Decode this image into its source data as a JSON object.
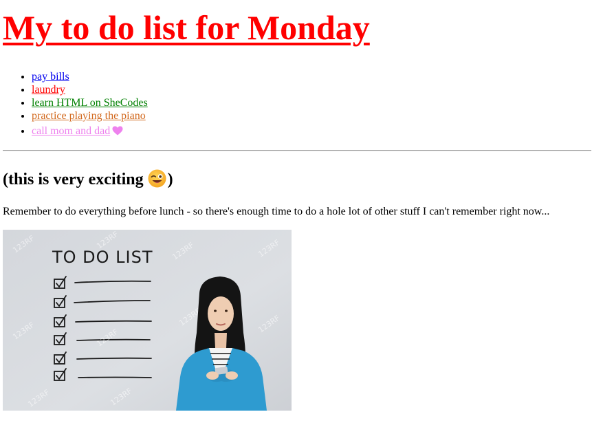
{
  "page": {
    "title": "My to do list for Monday",
    "todos": [
      {
        "label": "pay bills",
        "color": "#0000ee"
      },
      {
        "label": "laundry",
        "color": "#ff0000"
      },
      {
        "label": "learn HTML on SheCodes",
        "color": "#008000"
      },
      {
        "label": "practice playing the piano",
        "color": "#d2691e"
      },
      {
        "label": "call mom and dad",
        "color": "#ee82ee",
        "icon": "heart-icon"
      }
    ],
    "subtitle_prefix": "(this is very exciting",
    "subtitle_suffix": ")",
    "subtitle_icon": "winking-face-emoji",
    "note": "Remember to do everything before lunch - so there's enough time to do a hole lot of other stuff I can't remember right now...",
    "image": {
      "heading": "TO DO LIST",
      "checked_items": 6,
      "watermark": "123RF"
    }
  }
}
